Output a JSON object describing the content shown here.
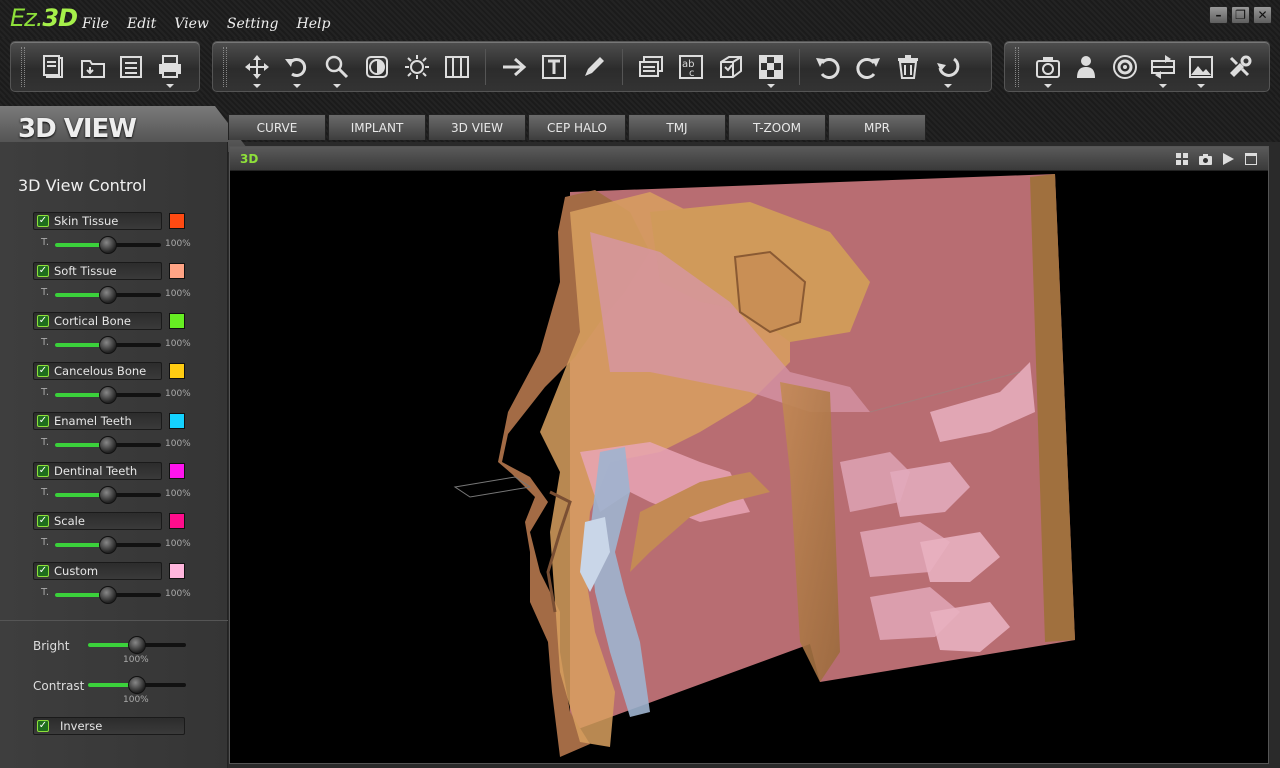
{
  "app": {
    "logo_part1": "Ez.",
    "logo_part2": "3D"
  },
  "menu": [
    "File",
    "Edit",
    "View",
    "Setting",
    "Help"
  ],
  "window_controls": [
    {
      "name": "minimize-icon",
      "glyph": "–"
    },
    {
      "name": "restore-icon",
      "glyph": "❐"
    },
    {
      "name": "close-icon",
      "glyph": "✕"
    }
  ],
  "toolbar": {
    "groups": [
      [
        "new-file-icon",
        "open-folder-icon",
        "save-icon",
        "print-icon"
      ],
      [
        "move-icon",
        "rotate-icon",
        "zoom-icon",
        "contrast-icon",
        "brightness-icon",
        "columns-icon",
        "arrow-icon",
        "text-icon",
        "pen-icon",
        "layers-icon",
        "abc-icon",
        "cube-icon",
        "checker-icon",
        "undo-icon",
        "redo-icon",
        "trash-icon",
        "reset-icon"
      ],
      [
        "camera-icon",
        "patient-icon",
        "disc-icon",
        "compare-icon",
        "image-icon",
        "tools-icon"
      ]
    ]
  },
  "view_title": "3D VIEW",
  "tabs": [
    "CURVE",
    "IMPLANT",
    "3D VIEW",
    "CEP HALO",
    "TMJ",
    "T-ZOOM",
    "MPR"
  ],
  "panel": {
    "title": "3D View Control",
    "t_label": "T.",
    "layers": [
      {
        "label": "Skin Tissue",
        "color": "#ff4a12",
        "value": "100%",
        "level": 0.5
      },
      {
        "label": "Soft Tissue",
        "color": "#ffa485",
        "value": "100%",
        "level": 0.5
      },
      {
        "label": "Cortical Bone",
        "color": "#66ee22",
        "value": "100%",
        "level": 0.5
      },
      {
        "label": "Cancelous Bone",
        "color": "#ffcc12",
        "value": "100%",
        "level": 0.5
      },
      {
        "label": "Enamel Teeth",
        "color": "#14d2ff",
        "value": "100%",
        "level": 0.5
      },
      {
        "label": "Dentinal Teeth",
        "color": "#ff14ee",
        "value": "100%",
        "level": 0.5
      },
      {
        "label": "Scale",
        "color": "#ff0d8c",
        "value": "100%",
        "level": 0.5
      },
      {
        "label": "Custom",
        "color": "#ffb6dd",
        "value": "100%",
        "level": 0.5
      }
    ],
    "bright": {
      "label": "Bright",
      "value": "100%",
      "level": 0.5
    },
    "contrast": {
      "label": "Contrast",
      "value": "100%",
      "level": 0.5
    },
    "inverse": {
      "label": "Inverse",
      "checked": true
    }
  },
  "viewport": {
    "title": "3D"
  },
  "accent": "#8ee03a"
}
